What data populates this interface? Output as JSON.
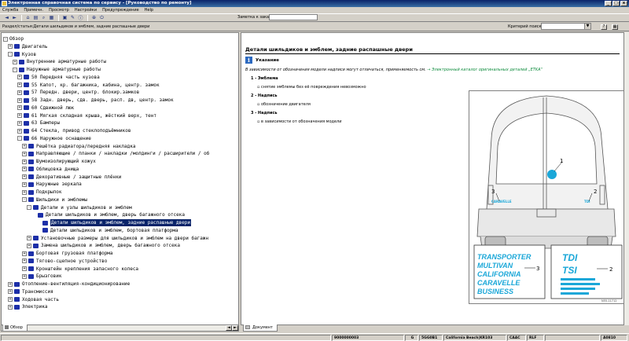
{
  "window": {
    "title": "Электронная справочная система по сервису - [Руководство по ремонту]",
    "controls": [
      "_",
      "□",
      "x"
    ]
  },
  "menu": [
    "Служба",
    "Примечн.",
    "Просмотр",
    "Настройки",
    "Предупреждение",
    "Help"
  ],
  "toolbar": {
    "order_label": "Заметка к заказу:",
    "order_value": ""
  },
  "breadcrumb": "Раздел/статья:Детали шильдиков и эмблем, задние распашные двери",
  "search": {
    "label": "Критерий поиска:",
    "value": ""
  },
  "tree": [
    {
      "label": "Обзор",
      "toggle": "-",
      "book": false
    },
    {
      "label": "Двигатель",
      "toggle": "+",
      "book": true
    },
    {
      "label": "Кузов",
      "toggle": "-",
      "book": true
    },
    {
      "label": "Внутренние арматурные работы",
      "toggle": "+",
      "book": true
    },
    {
      "label": "Наружные арматурные работы",
      "toggle": "-",
      "book": true
    },
    {
      "label": "50 Передняя часть кузова",
      "toggle": "+",
      "book": true
    },
    {
      "label": "55 Капот, кр. багажника, кабина, центр. замок",
      "toggle": "+",
      "book": true
    },
    {
      "label": "57 Передн. двери, центр. блокир.замков",
      "toggle": "+",
      "book": true
    },
    {
      "label": "58 Задн. дверь, сдв. дверь, расп. дв, центр. замок",
      "toggle": "+",
      "book": true
    },
    {
      "label": "60 Сдвижной люк",
      "toggle": "+",
      "book": true
    },
    {
      "label": "61 Мягкая складная крыша, жёсткий верх, тент",
      "toggle": "+",
      "book": true
    },
    {
      "label": "63 Бамперы",
      "toggle": "+",
      "book": true
    },
    {
      "label": "64 Стекла, привод стеклоподъёмников",
      "toggle": "+",
      "book": true
    },
    {
      "label": "66 Наружное оснащение",
      "toggle": "-",
      "book": true
    },
    {
      "label": "Решётка радиатора/передняя накладка",
      "toggle": "+",
      "book": true
    },
    {
      "label": "Направляющие / планки / накладки /молдинги / расширители / об",
      "toggle": "+",
      "book": true
    },
    {
      "label": "Шумоизолирующий кожух",
      "toggle": "+",
      "book": true
    },
    {
      "label": "Облицовка днища",
      "toggle": "+",
      "book": true
    },
    {
      "label": "Декоративные / защитные плёнки",
      "toggle": "+",
      "book": true
    },
    {
      "label": "Наружные зеркала",
      "toggle": "+",
      "book": true
    },
    {
      "label": "Подкрылок",
      "toggle": "+",
      "book": true
    },
    {
      "label": "Шильдики и эмблемы",
      "toggle": "-",
      "book": true
    },
    {
      "label": "Детали и узлы шильдиков и эмблем",
      "toggle": "-",
      "book": true
    },
    {
      "label": "Детали шильдиков и эмблем, дверь багажного отсека",
      "toggle": "",
      "book": true
    },
    {
      "label": "Детали шильдиков и эмблем, задние распашные двери",
      "toggle": "",
      "book": true
    },
    {
      "label": "Детали шильдиков и эмблем, бортовая платформа",
      "toggle": "",
      "book": true
    },
    {
      "label": "Установочные размеры для шильдиков и эмблем на двери багажн",
      "toggle": "+",
      "book": true
    },
    {
      "label": "Замена шильдиков и эмблем, дверь багажного отсека",
      "toggle": "+",
      "book": true
    },
    {
      "label": "Бортовая грузовая платформа",
      "toggle": "+",
      "book": true
    },
    {
      "label": "Тягово-сцепное устройство",
      "toggle": "+",
      "book": true
    },
    {
      "label": "Кронштейн крепления запасного колеса",
      "toggle": "+",
      "book": true
    },
    {
      "label": "Брызговик",
      "toggle": "+",
      "book": true
    },
    {
      "label": "Отопление-вентиляция-кондиционирование",
      "toggle": "+",
      "book": true
    },
    {
      "label": "Трансмиссия",
      "toggle": "+",
      "book": true
    },
    {
      "label": "Ходовая часть",
      "toggle": "+",
      "book": true
    },
    {
      "label": "Электрика",
      "toggle": "+",
      "book": true
    }
  ],
  "left_tab": "Обзор",
  "document": {
    "title": "Детали шильдиков и эмблем, задние распашные двери",
    "note_head": "Указание",
    "note_text": "В зависимости от обозначения модели надписи могут отличаться, применяемость см.",
    "note_link": "→ Электронный каталог оригинальных деталей „ETKA“",
    "items": [
      {
        "num": "1 -",
        "title": "Эмблема",
        "text": "снятие эмблемы без её повреждения невозможно"
      },
      {
        "num": "2 -",
        "title": "Надпись",
        "text": "обозначение двигателя"
      },
      {
        "num": "3 -",
        "title": "Надпись",
        "text": "в зависимости от обозначения модели"
      }
    ],
    "figure": {
      "callouts": [
        "1",
        "2",
        "3",
        "3",
        "2"
      ],
      "badge_small": "CARAVELLE",
      "badge_tdi": "TDI",
      "model_names": [
        "TRANSPORTER",
        "MULTIVAN",
        "CALIFORNIA",
        "CARAVELLE",
        "BUSINESS"
      ],
      "engine_names": [
        "TDI",
        "TSI"
      ],
      "tag": "N55-11712",
      "accent": "#1aa7d8"
    }
  },
  "right_tab": "Документ",
  "status": [
    "9000000003",
    "G",
    "5GG0B1",
    "California Beach|KR103",
    "CAAC",
    "RLF",
    "A0810"
  ]
}
